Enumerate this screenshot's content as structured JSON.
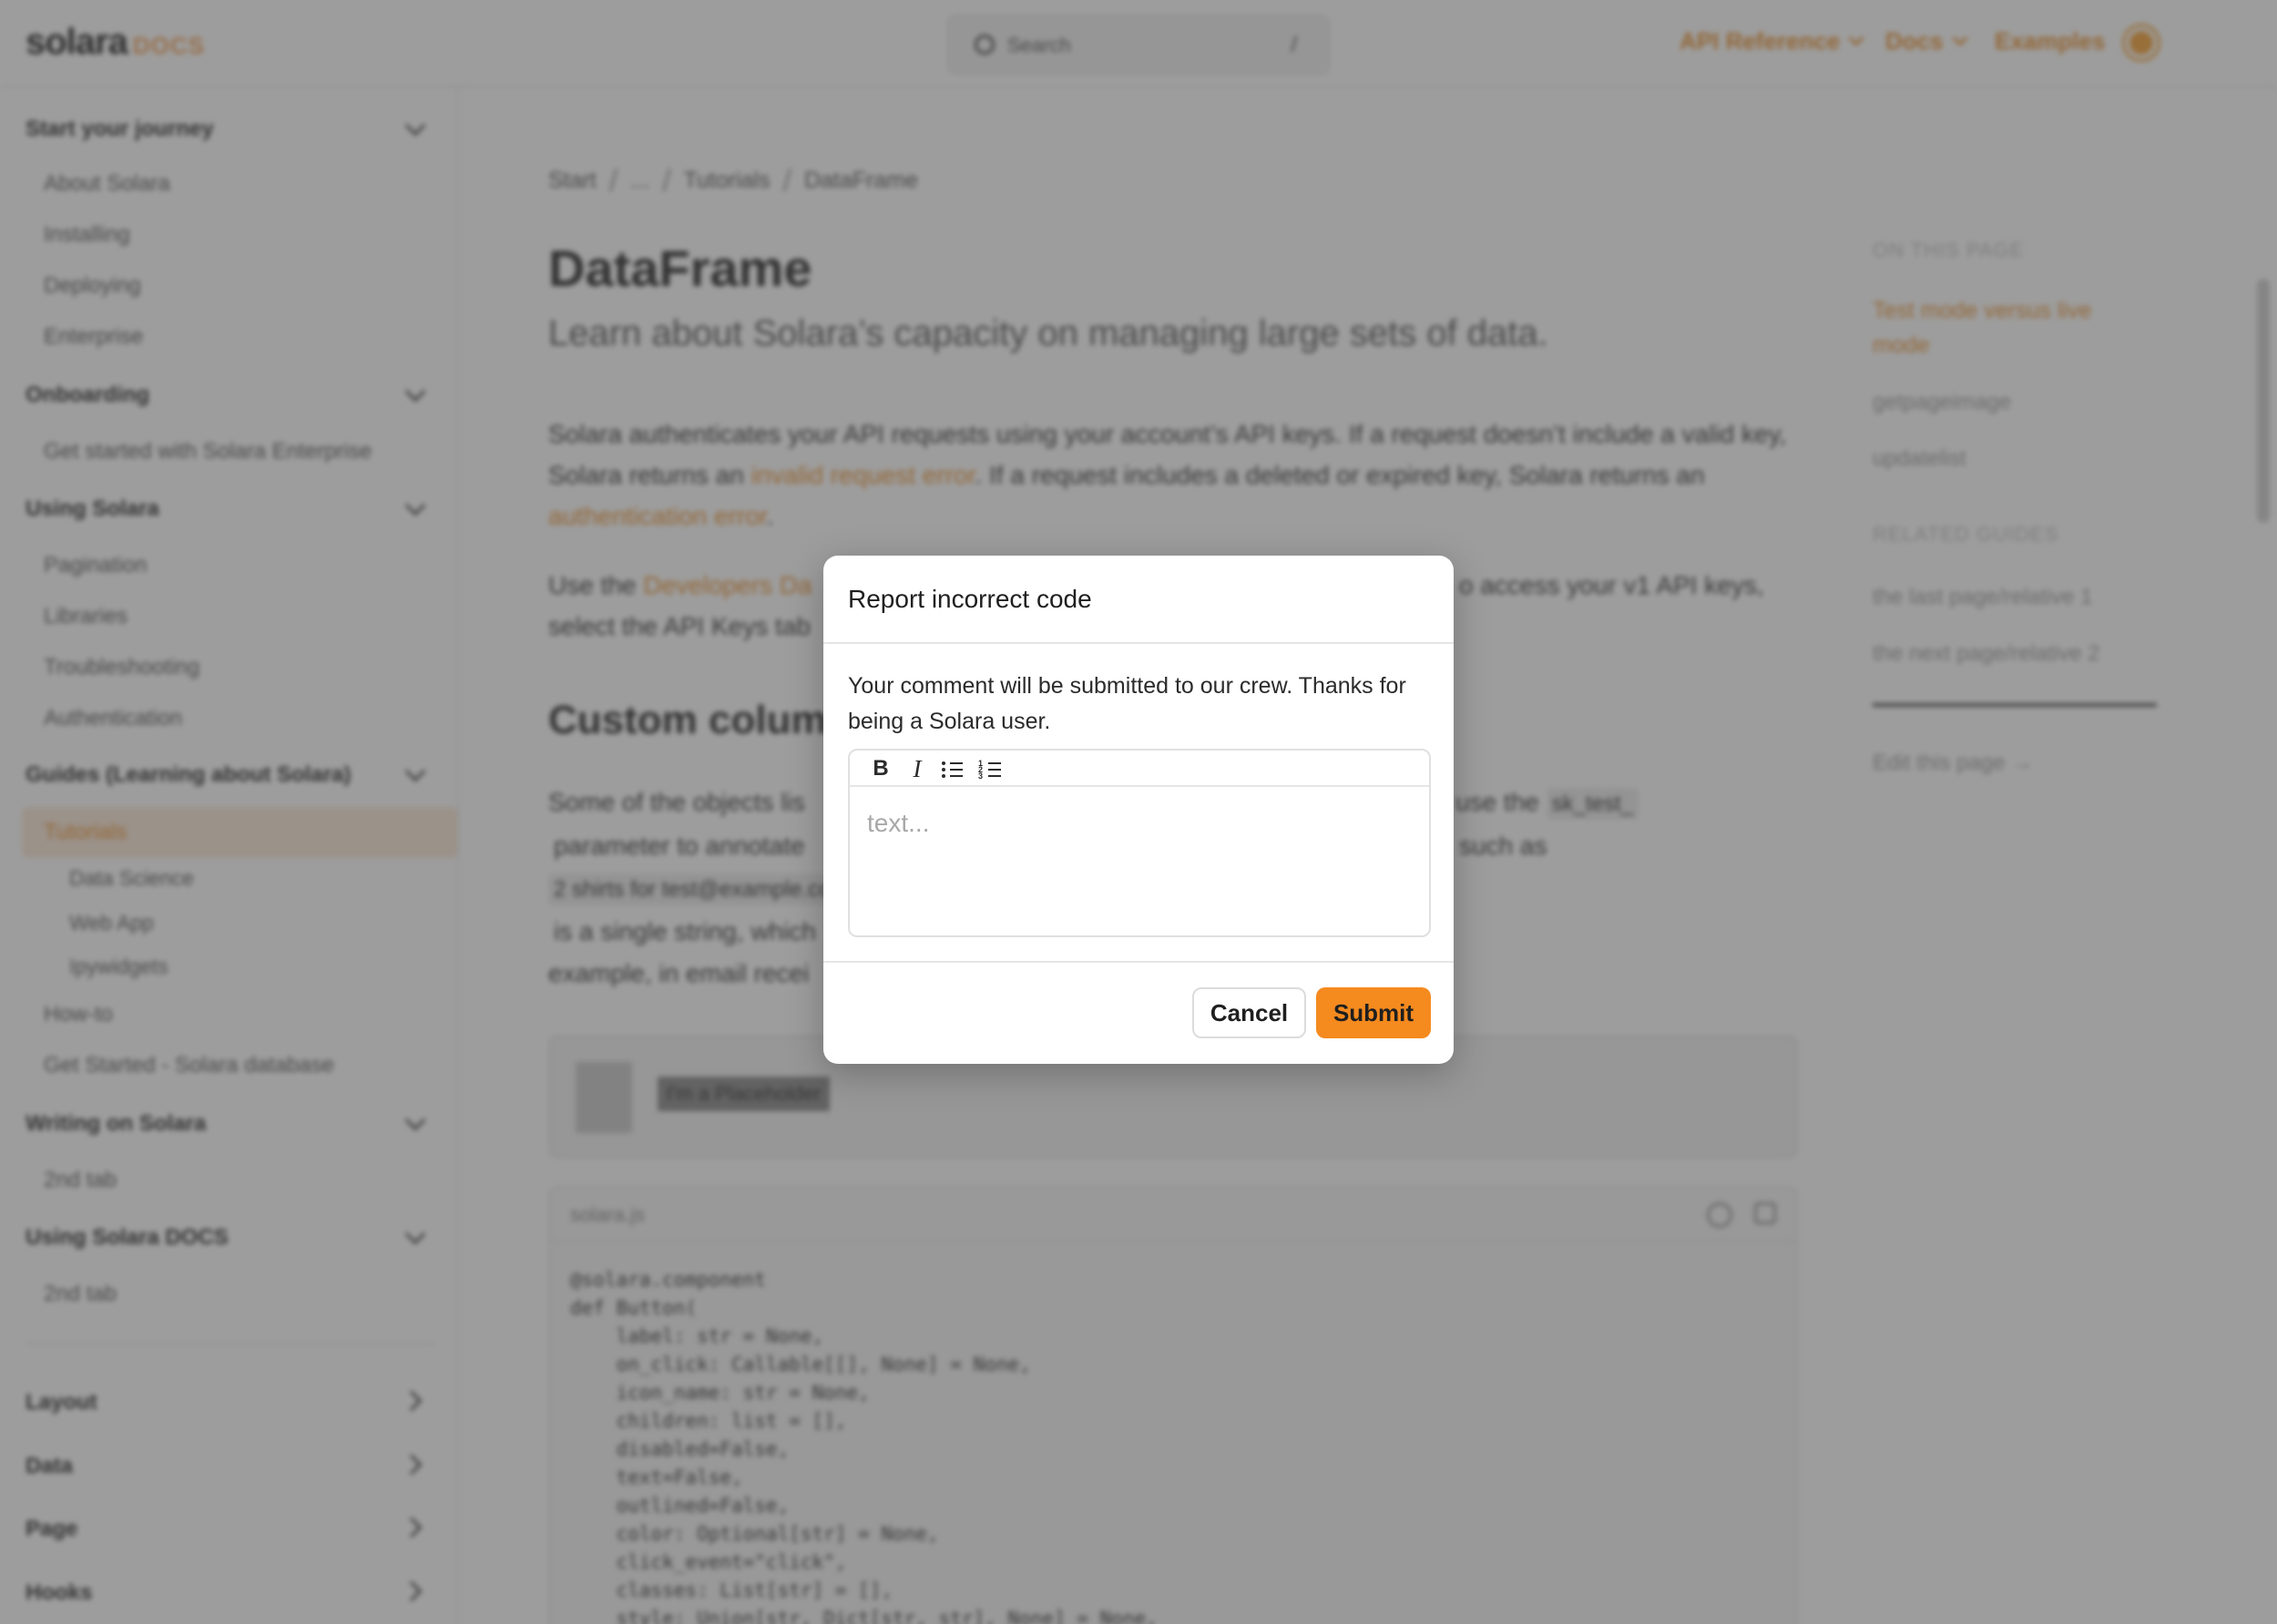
{
  "header": {
    "logo": "solara",
    "logo_suffix": "DOCS",
    "search_placeholder": "Search",
    "search_shortcut": "/",
    "nav": [
      "API Reference",
      "Docs",
      "Examples"
    ],
    "theme_icon": "sun-icon"
  },
  "sidebar": {
    "sections": [
      {
        "title": "Start your journey",
        "items": [
          "About Solara",
          "Installing",
          "Deploying",
          "Enterprise"
        ]
      },
      {
        "title": "Onboarding",
        "items": [
          "Get started with Solara Enterprise"
        ]
      },
      {
        "title": "Using Solara",
        "items": [
          "Pagination",
          "Libraries",
          "Troubleshooting",
          "Authentication"
        ]
      },
      {
        "title": "Guides (Learning about Solara)",
        "items": [
          "Tutorials",
          "How-to",
          "Get Started - Solara database"
        ],
        "sub_items": [
          "Data Science",
          "Web App",
          "Ipywidgets"
        ]
      },
      {
        "title": "Writing on Solara",
        "items": [
          "2nd tab"
        ]
      },
      {
        "title": "Using Solara DOCS",
        "items": [
          "2nd tab"
        ]
      }
    ],
    "collapsed": [
      "Layout",
      "Data",
      "Page",
      "Hooks"
    ],
    "active_item": "Tutorials"
  },
  "main": {
    "breadcrumb": [
      "Start",
      "...",
      "Tutorials",
      "DataFrame"
    ],
    "title": "DataFrame",
    "lead": "Learn about Solara’s capacity on managing large sets of data.",
    "p1_a": "Solara authenticates your API requests using your account’s API keys. If a request doesn’t include a valid key, Solara returns an ",
    "p1_link1": "invalid request error",
    "p1_b": ". If a request includes a deleted or expired key, Solara returns an ",
    "p1_link2": "authentication error",
    "p1_c": ".",
    "p2_a": "Use the ",
    "p2_link": "Developers Da",
    "p2_right": "o access your v1 API keys,",
    "p2_line2": "select the API Keys tab",
    "h2": "Custom column",
    "p3_l1": "Some of the objects lis",
    "p3_l1_right": "use the",
    "p3_code1": "sk_test_",
    "p3_l2": "parameter to annotate",
    "p3_l2_right": "such as",
    "p3_code2": "2 shirts for test@example.co",
    "p3_l3": "is a single string, which",
    "p3_l4": "example, in email recei",
    "placeholder_tag": "I'm a Placeholder",
    "code_file": "solara.js",
    "code_lines": [
      "@solara.component",
      "def Button(",
      "    label: str = None,",
      "    on_click: Callable[[], None] = None,",
      "    icon_name: str = None,",
      "    children: list = [],",
      "    disabled=False,",
      "    text=False,",
      "    outlined=False,",
      "    color: Optional[str] = None,",
      "    click_event=\"click\",",
      "    classes: List[str] = [],",
      "    style: Union[str, Dict[str, str], None] = None,"
    ]
  },
  "toc": {
    "heading": "ON THIS PAGE",
    "active": "Test mode versus live mode",
    "items": [
      "getpageimage",
      "updatelist"
    ],
    "related_heading": "RELATED GUIDES",
    "related": [
      "the last page/relative 1",
      "the next page/relative 2"
    ],
    "edit": "Edit this page →"
  },
  "modal": {
    "title": "Report incorrect code",
    "description": "Your comment will be submitted to our crew. Thanks for being a Solara user.",
    "editor_placeholder": "text...",
    "toolbar": {
      "bold": "B",
      "italic": "I"
    },
    "cancel_label": "Cancel",
    "submit_label": "Submit",
    "accent_color": "#f58a1f"
  }
}
